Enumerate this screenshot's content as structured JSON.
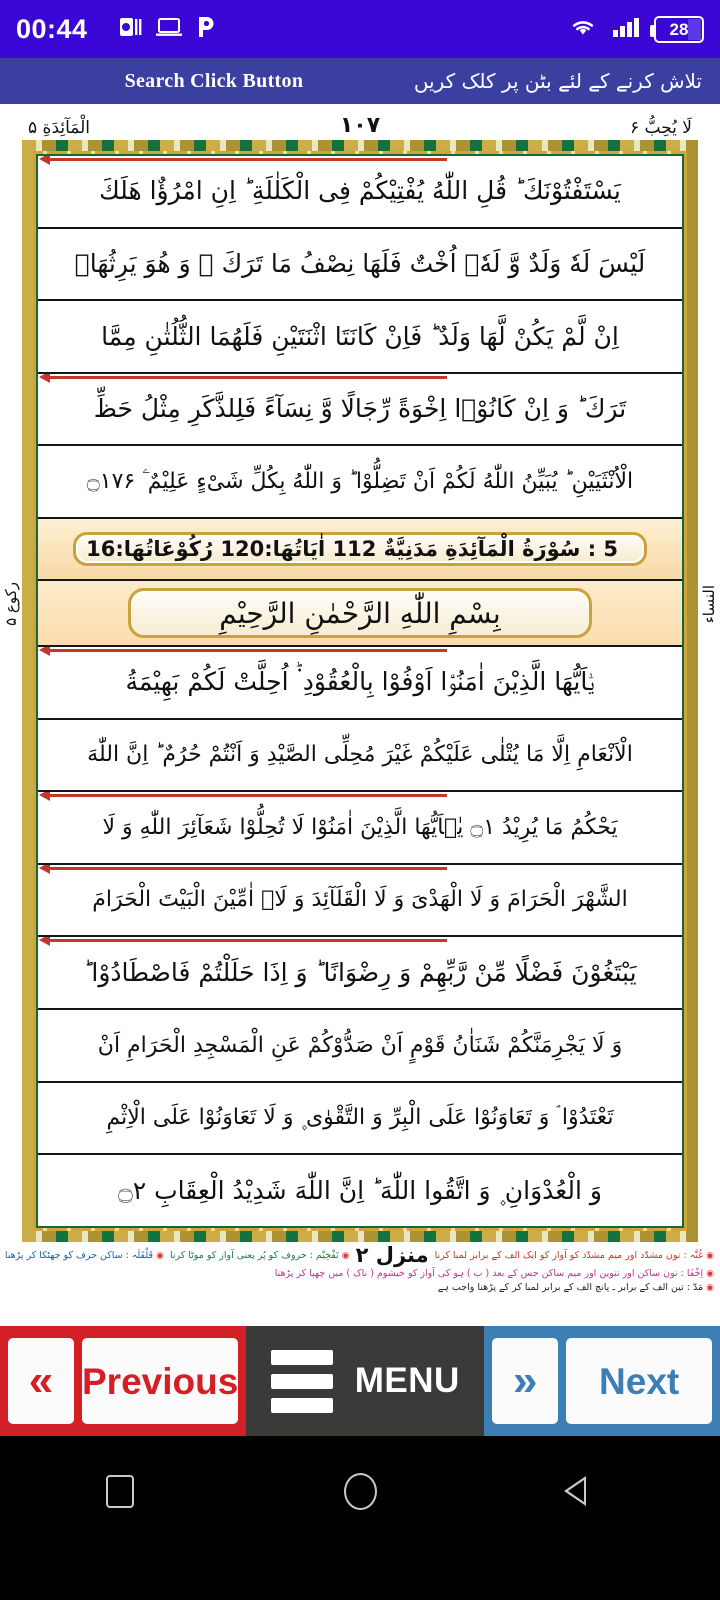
{
  "status_bar": {
    "time": "00:44",
    "battery_percent": "28",
    "icons": [
      "powerpoint-icon",
      "laptop-icon",
      "p-app-icon",
      "wifi-icon",
      "signal-icon",
      "battery-icon"
    ],
    "background_color": "#3a07d6"
  },
  "app_header": {
    "english_label": "Search Click Button",
    "urdu_label": "تلاش کرنے کے لئے بٹن پر کلک کریں",
    "background_color": "#3b3fa0"
  },
  "page_header": {
    "surah_name": "الْمَآئِدَةِ ۵",
    "page_number": "۱۰۷",
    "juz_name": "لَا یُحِبُّ ۶"
  },
  "margins": {
    "left_text": "رکوع ۵",
    "right_text": "النساء"
  },
  "quran_lines": [
    {
      "text": "یَسْتَفْتُوْنَكَ ؕ قُلِ اللّٰهُ یُفْتِیْكُمْ فِی الْكَلٰلَةِ ؕ اِنِ امْرُؤٌا هَلَكَ",
      "arrow": true
    },
    {
      "text": "لَیْسَ لَهٗ وَلَدٌ وَّ لَهٗۤ اُخْتٌ فَلَهَا نِصْفُ مَا تَرَكَ ۚ وَ هُوَ یَرِثُهَاۤ",
      "arrow": false
    },
    {
      "text": "اِنْ لَّمْ یَكُنْ لَّهَا وَلَدٌ ؕ فَاِنْ كَانَتَا اثْنَتَیْنِ فَلَهُمَا الثُّلُثٰنِ مِمَّا",
      "arrow": false
    },
    {
      "text": "تَرَكَ ؕ وَ اِنْ كَانُوْۤا اِخْوَةً رِّجَالًا وَّ نِسَآءً فَلِلذَّكَرِ مِثْلُ حَظِّ",
      "arrow": true
    },
    {
      "text": "الْاُنْثَیَیْنِ ؕ یُبَیِّنُ اللّٰهُ لَكُمْ اَنْ تَضِلُّوْا ؕ وَ اللّٰهُ بِكُلِّ شَیْءٍ عَلِیْمٌ ۧ ۝۱۷۶",
      "arrow": false
    }
  ],
  "surah_banner": {
    "text": "5 : سُوْرَةُ الْمَآئِدَةِ مَدَنِیَّةٌ 112 اٰیَاتُهَا:120 رُكُوْعَاتُهَا:16"
  },
  "bismillah": {
    "text": "بِسْمِ اللّٰهِ الرَّحْمٰنِ الرَّحِیْمِ"
  },
  "quran_lines_2": [
    {
      "text": "یٰۤاَیُّهَا الَّذِیْنَ اٰمَنُوْۤا اَوْفُوْا بِالْعُقُوْدِ ۬ؕ اُحِلَّتْ لَكُمْ بَهِیْمَةُ",
      "arrow": true
    },
    {
      "text": "الْاَنْعَامِ اِلَّا مَا یُتْلٰی عَلَیْكُمْ غَیْرَ مُحِلِّی الصَّیْدِ وَ اَنْتُمْ حُرُمٌ ؕ اِنَّ اللّٰهَ",
      "arrow": false
    },
    {
      "text": "یَحْكُمُ مَا یُرِیْدُ ۝۱ یٰۤاَیُّهَا الَّذِیْنَ اٰمَنُوْا لَا تُحِلُّوْا شَعَآئِرَ اللّٰهِ وَ لَا",
      "arrow": true
    },
    {
      "text": "الشَّهْرَ الْحَرَامَ وَ لَا الْهَدْیَ وَ لَا الْقَلَآئِدَ وَ لَاۤ اٰمِّیْنَ الْبَیْتَ الْحَرَامَ",
      "arrow": true
    },
    {
      "text": "یَبْتَغُوْنَ فَضْلًا مِّنْ رَّبِّهِمْ وَ رِضْوَانًا ؕ وَ اِذَا حَلَلْتُمْ فَاصْطَادُوْا ؕ",
      "arrow": true
    },
    {
      "text": "وَ لَا یَجْرِمَنَّكُمْ شَنَاٰنُ قَوْمٍ اَنْ صَدُّوْكُمْ عَنِ الْمَسْجِدِ الْحَرَامِ اَنْ",
      "arrow": false
    },
    {
      "text": "تَعْتَدُوْا ۘ وَ تَعَاوَنُوْا عَلَی الْبِرِّ وَ التَّقْوٰی ۪ وَ لَا تَعَاوَنُوْا عَلَی الْاِثْمِ",
      "arrow": false
    },
    {
      "text": "وَ الْعُدْوَانِ ۪ وَ اتَّقُوا اللّٰهَ ؕ اِنَّ اللّٰهَ شَدِیْدُ الْعِقَابِ ۝۲",
      "arrow": false
    }
  ],
  "footer": {
    "manzil": "منزل ۲",
    "rules": [
      {
        "color": "red",
        "text": "غُنَّہ : نون مشدّد اور میم مشدّد کو آواز کو ایک الف کے برابر لمبا کرنا"
      },
      {
        "color": "green",
        "text": "تَفْخِیْم : حروف کو پُر یعنی آواز کو موٹا کرنا"
      },
      {
        "color": "blue",
        "text": "قَلْقَلَہ : ساکن حرف کو جھٹکا کر پڑھنا"
      },
      {
        "color": "pink",
        "text": "اِخْفَا : نون ساکن اور تنوین اور میم ساکن جس کے بعد ( ب ) ہو کی آواز کو خیشوم ( ناک ) میں چھپا کر پڑھنا"
      },
      {
        "color": "dark",
        "text": "مَدّ : تین الف کے برابر ـ پانچ الف کے برابر لمبا کر کے پڑھنا واجب ہے"
      }
    ]
  },
  "bottom_nav": {
    "previous_label": "Previous",
    "previous_icon": "double-chevron-left-icon",
    "previous_color": "#d32027",
    "menu_label": "MENU",
    "menu_icon": "hamburger-icon",
    "menu_color": "#3a3a38",
    "next_label": "Next",
    "next_icon": "double-chevron-right-icon",
    "next_color": "#3d7fb5"
  },
  "android_nav": {
    "recents": "recents-square-icon",
    "home": "home-circle-icon",
    "back": "back-triangle-icon"
  }
}
